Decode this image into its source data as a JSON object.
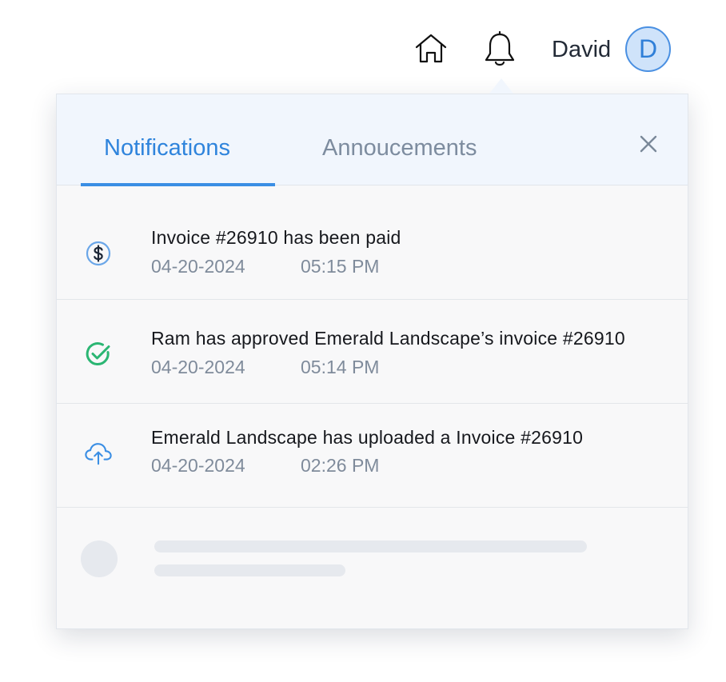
{
  "header": {
    "home_icon": "home-icon",
    "bell_icon": "bell-icon",
    "user_name": "David",
    "avatar_initial": "D"
  },
  "panel": {
    "tabs": [
      {
        "label": "Notifications",
        "active": true
      },
      {
        "label": "Annoucements",
        "active": false
      }
    ],
    "close_icon": "close-icon",
    "notifications": [
      {
        "icon": "dollar-circle-icon",
        "title": "Invoice #26910 has been paid",
        "date": "04-20-2024",
        "time": "05:15 PM"
      },
      {
        "icon": "check-circle-icon",
        "title": "Ram has approved Emerald Landscape’s invoice #26910",
        "date": "04-20-2024",
        "time": "05:14 PM"
      },
      {
        "icon": "cloud-upload-icon",
        "title": "Emerald Landscape has uploaded a Invoice #26910",
        "date": "04-20-2024",
        "time": "02:26 PM"
      }
    ]
  },
  "colors": {
    "accent": "#2f84dc",
    "panel_bg": "#f8f8f9",
    "tab_bar_bg": "#f1f6fd",
    "success": "#2bb673",
    "muted_text": "#7f8b9b"
  }
}
